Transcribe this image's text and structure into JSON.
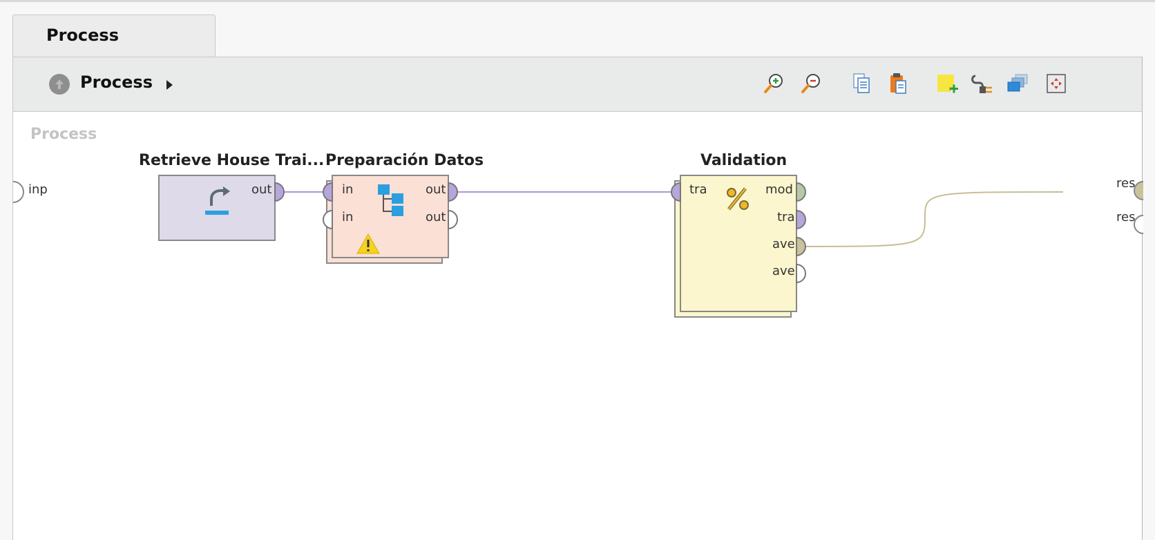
{
  "tab": {
    "label": "Process"
  },
  "breadcrumb": {
    "label": "Process"
  },
  "toolbar": {
    "icons": [
      "zoom-in-icon",
      "zoom-out-icon",
      "copy-icon",
      "paste-icon",
      "add-note-icon",
      "connect-icon",
      "layers-icon",
      "fit-icon"
    ]
  },
  "canvas": {
    "title": "Process",
    "input_port": "inp",
    "result_ports": [
      "res",
      "res"
    ]
  },
  "operators": {
    "retrieve": {
      "title": "Retrieve House Trai...",
      "ports_out": [
        "out"
      ]
    },
    "prep": {
      "title": "Preparación Datos",
      "ports_in": [
        "in",
        "in"
      ],
      "ports_out": [
        "out",
        "out"
      ]
    },
    "validation": {
      "title": "Validation",
      "ports_in": [
        "tra"
      ],
      "ports_out": [
        "mod",
        "tra",
        "ave",
        "ave"
      ]
    }
  },
  "colors": {
    "retrieve_fill": "#dedae9",
    "prep_fill": "#fbe0d6",
    "validation_fill": "#fbf6cd",
    "port_purple": "#b6a6db",
    "port_green": "#b8c8a6",
    "port_khaki": "#c9c29c",
    "wire_purple": "#a79bd3",
    "wire_khaki": "#c7be92"
  }
}
